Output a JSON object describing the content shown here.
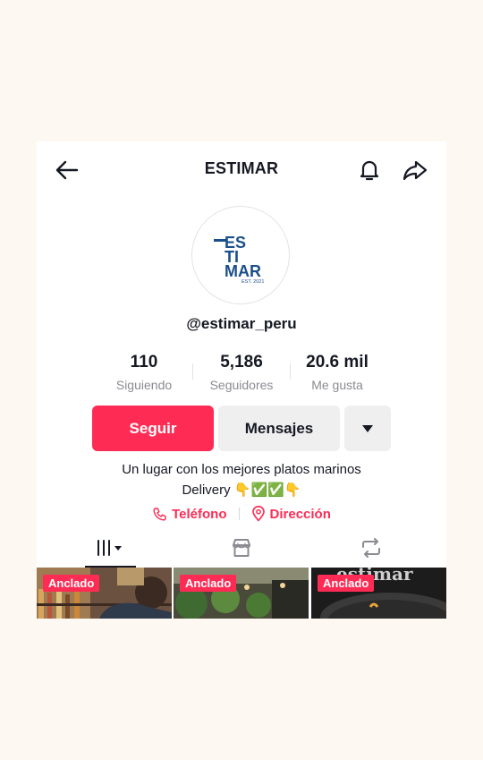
{
  "header": {
    "title": "ESTIMAR"
  },
  "profile": {
    "handle": "@estimar_peru",
    "logo_text": {
      "line1": "ES",
      "line2": "TI",
      "line3": "MAR",
      "est": "EST. 2021"
    }
  },
  "stats": [
    {
      "value": "110",
      "label": "Siguiendo"
    },
    {
      "value": "5,186",
      "label": "Seguidores"
    },
    {
      "value": "20.6 mil",
      "label": "Me gusta"
    }
  ],
  "actions": {
    "follow": "Seguir",
    "message": "Mensajes"
  },
  "bio": {
    "line1": "Un lugar con los mejores platos marinos",
    "line2": "Delivery 👇✅✅👇"
  },
  "links": {
    "phone": "Teléfono",
    "address": "Dirección"
  },
  "videos": [
    {
      "badge": "Anclado"
    },
    {
      "badge": "Anclado"
    },
    {
      "badge": "Anclado"
    }
  ],
  "colors": {
    "accent": "#fe2c55",
    "text": "#161823",
    "muted": "#8a8b91",
    "logo": "#1b4f8a"
  },
  "icons": [
    "back-arrow-icon",
    "bell-icon",
    "share-icon",
    "caret-down-icon",
    "phone-icon",
    "location-pin-icon",
    "grid-icon",
    "shop-icon",
    "repost-icon"
  ]
}
